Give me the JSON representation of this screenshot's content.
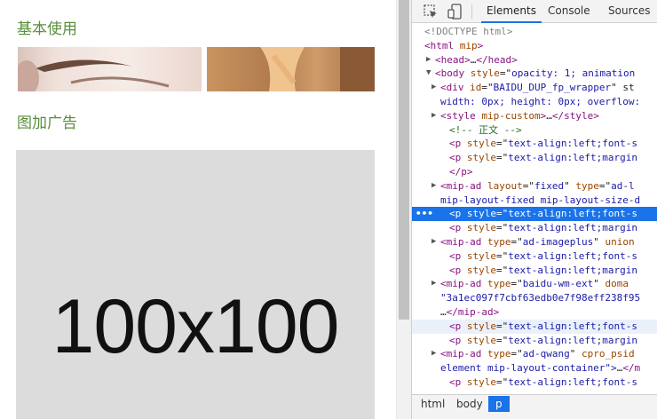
{
  "page": {
    "heading_basic": "基本使用",
    "heading_ad": "图加广告",
    "ad_placeholder": "100x100"
  },
  "devtools": {
    "tabs": [
      "Elements",
      "Console",
      "Sources"
    ],
    "active_tab": "Elements",
    "lines": [
      {
        "segments": [
          {
            "t": "<!DOCTYPE html>",
            "c": "dt"
          }
        ]
      },
      {
        "segments": [
          {
            "t": "<html ",
            "c": "tag"
          },
          {
            "t": "mip",
            "c": "attr"
          },
          {
            "t": ">",
            "c": "tag"
          }
        ]
      },
      {
        "tri": "▶",
        "segments": [
          {
            "t": "<head>",
            "c": "tag"
          },
          {
            "t": "…",
            "c": ""
          },
          {
            "t": "</head>",
            "c": "tag"
          }
        ]
      },
      {
        "tri": "▼",
        "segments": [
          {
            "t": "<body ",
            "c": "tag"
          },
          {
            "t": "style",
            "c": "attr"
          },
          {
            "t": "=\"",
            "c": ""
          },
          {
            "t": "opacity: 1; animation",
            "c": "val"
          }
        ]
      },
      {
        "tri": "▶",
        "segments": [
          {
            "t": "<div ",
            "c": "tag"
          },
          {
            "t": "id",
            "c": "attr"
          },
          {
            "t": "=\"",
            "c": ""
          },
          {
            "t": "BAIDU_DUP_fp_wrapper",
            "c": "val"
          },
          {
            "t": "\" st",
            "c": ""
          }
        ]
      },
      {
        "segments": [
          {
            "t": "width: 0px; height: 0px; overflow:",
            "c": "val"
          }
        ]
      },
      {
        "tri": "▶",
        "segments": [
          {
            "t": "<style ",
            "c": "tag"
          },
          {
            "t": "mip-custom",
            "c": "attr"
          },
          {
            "t": ">",
            "c": "tag"
          },
          {
            "t": "…",
            "c": ""
          },
          {
            "t": "</style>",
            "c": "tag"
          }
        ]
      },
      {
        "segments": [
          {
            "t": "<!-- 正文 -->",
            "c": "cmt"
          }
        ]
      },
      {
        "segments": [
          {
            "t": "<p ",
            "c": "tag"
          },
          {
            "t": "style",
            "c": "attr"
          },
          {
            "t": "=\"",
            "c": ""
          },
          {
            "t": "text-align:left;font-s",
            "c": "val"
          }
        ]
      },
      {
        "segments": [
          {
            "t": "<p ",
            "c": "tag"
          },
          {
            "t": "style",
            "c": "attr"
          },
          {
            "t": "=\"",
            "c": ""
          },
          {
            "t": "text-align:left;margin",
            "c": "val"
          }
        ]
      },
      {
        "segments": [
          {
            "t": "</p>",
            "c": "tag"
          }
        ]
      },
      {
        "tri": "▶",
        "segments": [
          {
            "t": "<mip-ad ",
            "c": "tag"
          },
          {
            "t": "layout",
            "c": "attr"
          },
          {
            "t": "=\"",
            "c": ""
          },
          {
            "t": "fixed",
            "c": "val"
          },
          {
            "t": "\" ",
            "c": ""
          },
          {
            "t": "type",
            "c": "attr"
          },
          {
            "t": "=\"",
            "c": ""
          },
          {
            "t": "ad-l",
            "c": "val"
          }
        ]
      },
      {
        "segments": [
          {
            "t": "mip-layout-fixed mip-layout-size-d",
            "c": "val"
          }
        ]
      },
      {
        "selected": true,
        "segments": [
          {
            "t": "<p ",
            "c": "tag"
          },
          {
            "t": "style",
            "c": "attr"
          },
          {
            "t": "=\"",
            "c": ""
          },
          {
            "t": "text-align:left;font-s",
            "c": "val"
          }
        ]
      },
      {
        "segments": [
          {
            "t": "<p ",
            "c": "tag"
          },
          {
            "t": "style",
            "c": "attr"
          },
          {
            "t": "=\"",
            "c": ""
          },
          {
            "t": "text-align:left;margin",
            "c": "val"
          }
        ]
      },
      {
        "tri": "▶",
        "segments": [
          {
            "t": "<mip-ad ",
            "c": "tag"
          },
          {
            "t": "type",
            "c": "attr"
          },
          {
            "t": "=\"",
            "c": ""
          },
          {
            "t": "ad-imageplus",
            "c": "val"
          },
          {
            "t": "\" ",
            "c": ""
          },
          {
            "t": "union",
            "c": "attr"
          }
        ]
      },
      {
        "segments": [
          {
            "t": "<p ",
            "c": "tag"
          },
          {
            "t": "style",
            "c": "attr"
          },
          {
            "t": "=\"",
            "c": ""
          },
          {
            "t": "text-align:left;font-s",
            "c": "val"
          }
        ]
      },
      {
        "segments": [
          {
            "t": "<p ",
            "c": "tag"
          },
          {
            "t": "style",
            "c": "attr"
          },
          {
            "t": "=\"",
            "c": ""
          },
          {
            "t": "text-align:left;margin",
            "c": "val"
          }
        ]
      },
      {
        "tri": "▶",
        "segments": [
          {
            "t": "<mip-ad ",
            "c": "tag"
          },
          {
            "t": "type",
            "c": "attr"
          },
          {
            "t": "=\"",
            "c": ""
          },
          {
            "t": "baidu-wm-ext",
            "c": "val"
          },
          {
            "t": "\" ",
            "c": ""
          },
          {
            "t": "doma",
            "c": "attr"
          }
        ]
      },
      {
        "segments": [
          {
            "t": "\"3a1ec097f7cbf63edb0e7f98eff238f95",
            "c": "val"
          }
        ]
      },
      {
        "segments": [
          {
            "t": "…",
            "c": ""
          },
          {
            "t": "</mip-ad>",
            "c": "tag"
          }
        ]
      },
      {
        "hover": true,
        "segments": [
          {
            "t": "<p ",
            "c": "tag"
          },
          {
            "t": "style",
            "c": "attr"
          },
          {
            "t": "=\"",
            "c": ""
          },
          {
            "t": "text-align:left;font-s",
            "c": "val"
          }
        ]
      },
      {
        "segments": [
          {
            "t": "<p ",
            "c": "tag"
          },
          {
            "t": "style",
            "c": "attr"
          },
          {
            "t": "=\"",
            "c": ""
          },
          {
            "t": "text-align:left;margin",
            "c": "val"
          }
        ]
      },
      {
        "tri": "▶",
        "segments": [
          {
            "t": "<mip-ad ",
            "c": "tag"
          },
          {
            "t": "type",
            "c": "attr"
          },
          {
            "t": "=\"",
            "c": ""
          },
          {
            "t": "ad-qwang",
            "c": "val"
          },
          {
            "t": "\" ",
            "c": ""
          },
          {
            "t": "cpro_psid",
            "c": "attr"
          }
        ]
      },
      {
        "segments": [
          {
            "t": "element mip-layout-container\">",
            "c": "val"
          },
          {
            "t": "…",
            "c": ""
          },
          {
            "t": "</m",
            "c": "tag"
          }
        ]
      },
      {
        "segments": [
          {
            "t": "<p ",
            "c": "tag"
          },
          {
            "t": "style",
            "c": "attr"
          },
          {
            "t": "=\"",
            "c": ""
          },
          {
            "t": "text-align:left;font-s",
            "c": "val"
          }
        ]
      }
    ],
    "breadcrumb": [
      "html",
      "body",
      "p"
    ]
  },
  "colors": {
    "heading": "#5a8f3a",
    "selected_row": "#1a73e8",
    "ad_background": "#dcdcdc"
  },
  "icons": [
    "inspect-element-icon",
    "device-toolbar-icon"
  ]
}
